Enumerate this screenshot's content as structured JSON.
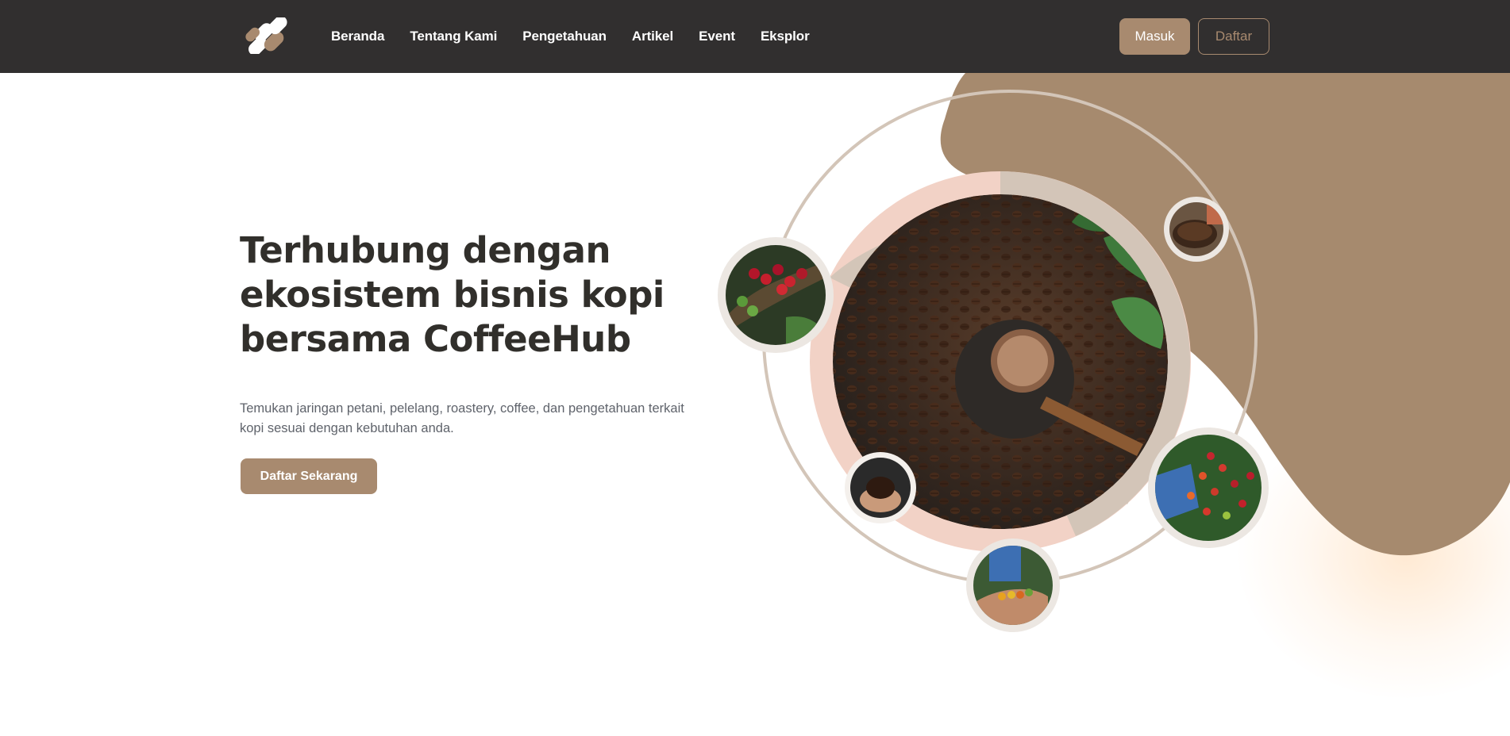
{
  "brand": {
    "logo_icon": "coffeehub-logo-icon"
  },
  "nav": {
    "items": [
      {
        "label": "Beranda"
      },
      {
        "label": "Tentang Kami"
      },
      {
        "label": "Pengetahuan"
      },
      {
        "label": "Artikel"
      },
      {
        "label": "Event"
      },
      {
        "label": "Eksplor"
      }
    ],
    "login_label": "Masuk",
    "register_label": "Daftar"
  },
  "hero": {
    "title_line1": "Terhubung dengan",
    "title_line2": "ekosistem bisnis kopi",
    "title_line3": "bersama CoffeeHub",
    "subtitle": "Temukan jaringan petani, pelelang, roastery, coffee, dan pengetahuan terkait kopi sesuai dengan kebutuhan anda.",
    "cta_label": "Daftar Sekarang"
  },
  "images": {
    "main": "coffee-beans-turkish-pot-photo",
    "top_left": "coffee-cherries-branch-photo",
    "top_right": "coffee-beans-basket-photo",
    "bottom_left": "hands-holding-beans-photo",
    "bottom_center": "hand-holding-cherries-photo",
    "bottom_right": "coffee-plant-harvest-photo"
  },
  "colors": {
    "navbar": "#312f2f",
    "accent": "#a88a6f",
    "title": "#312f2b",
    "subtitle": "#5f636b",
    "blob": "#a68a6e",
    "ring": "#d3c5b8",
    "peach": "#f2d2c6"
  }
}
